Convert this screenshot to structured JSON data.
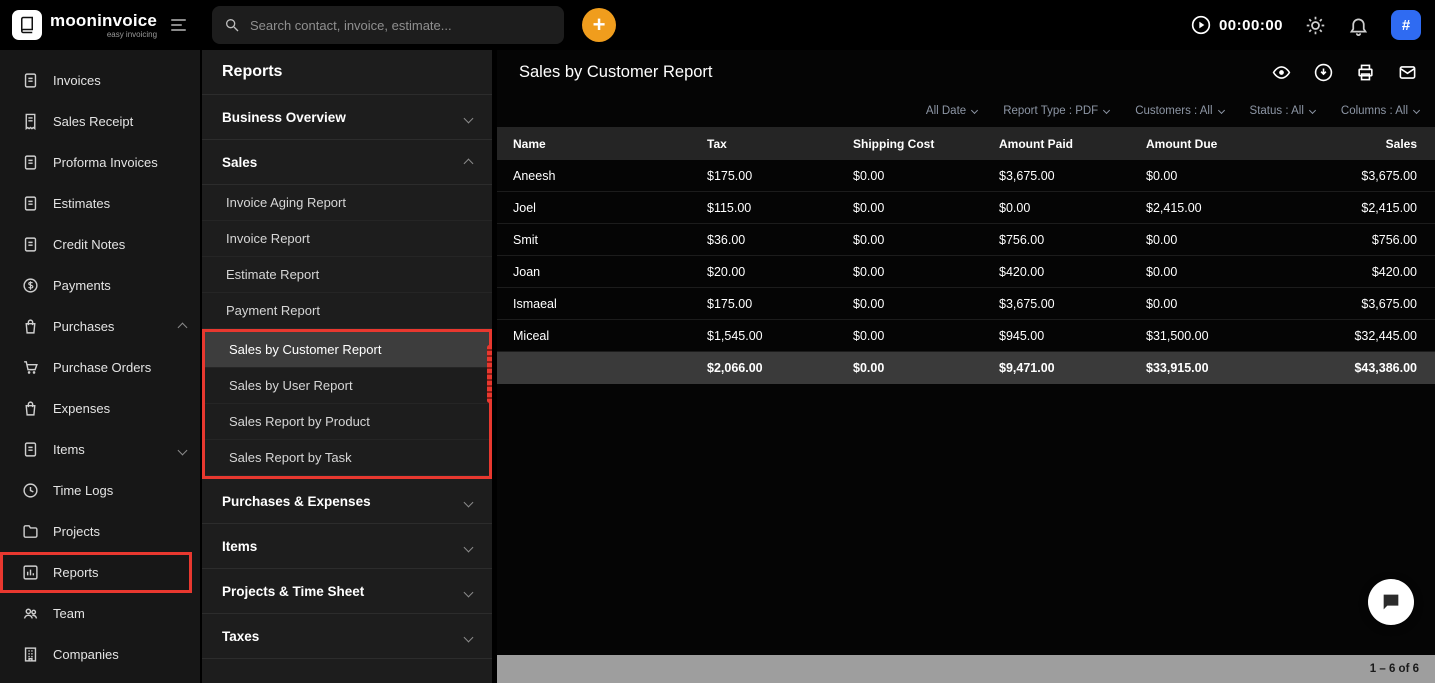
{
  "topbar": {
    "logo_text": "mooninvoice",
    "logo_tagline": "easy invoicing",
    "search_placeholder": "Search contact, invoice, estimate...",
    "add_label": "+",
    "timer": "00:00:00",
    "hash_label": "#"
  },
  "sidebar": {
    "items": [
      {
        "label": "Invoices"
      },
      {
        "label": "Sales Receipt"
      },
      {
        "label": "Proforma Invoices"
      },
      {
        "label": "Estimates"
      },
      {
        "label": "Credit Notes"
      },
      {
        "label": "Payments"
      },
      {
        "label": "Purchases"
      },
      {
        "label": "Purchase Orders"
      },
      {
        "label": "Expenses"
      },
      {
        "label": "Items"
      },
      {
        "label": "Time Logs"
      },
      {
        "label": "Projects"
      },
      {
        "label": "Reports"
      },
      {
        "label": "Team"
      },
      {
        "label": "Companies"
      }
    ]
  },
  "reports_panel": {
    "title": "Reports",
    "sections": [
      {
        "label": "Business Overview",
        "state": "collapsed"
      },
      {
        "label": "Sales",
        "state": "expanded"
      },
      {
        "label": "Purchases & Expenses",
        "state": "collapsed"
      },
      {
        "label": "Items",
        "state": "collapsed"
      },
      {
        "label": "Projects & Time Sheet",
        "state": "collapsed"
      },
      {
        "label": "Taxes",
        "state": "collapsed"
      }
    ],
    "sales_items": [
      {
        "label": "Invoice Aging Report"
      },
      {
        "label": "Invoice Report"
      },
      {
        "label": "Estimate Report"
      },
      {
        "label": "Payment Report"
      },
      {
        "label": "Sales by Customer Report",
        "selected": true
      },
      {
        "label": "Sales by User Report"
      },
      {
        "label": "Sales Report by Product"
      },
      {
        "label": "Sales Report by Task"
      }
    ]
  },
  "main": {
    "title": "Sales by Customer Report",
    "filters": [
      {
        "label": "All Date"
      },
      {
        "label": "Report Type : PDF"
      },
      {
        "label": "Customers : All"
      },
      {
        "label": "Status : All"
      },
      {
        "label": "Columns : All"
      }
    ],
    "table": {
      "columns": [
        "Name",
        "Tax",
        "Shipping Cost",
        "Amount Paid",
        "Amount Due",
        "Sales"
      ],
      "rows": [
        [
          "Aneesh",
          "$175.00",
          "$0.00",
          "$3,675.00",
          "$0.00",
          "$3,675.00"
        ],
        [
          "Joel",
          "$115.00",
          "$0.00",
          "$0.00",
          "$2,415.00",
          "$2,415.00"
        ],
        [
          "Smit",
          "$36.00",
          "$0.00",
          "$756.00",
          "$0.00",
          "$756.00"
        ],
        [
          "Joan",
          "$20.00",
          "$0.00",
          "$420.00",
          "$0.00",
          "$420.00"
        ],
        [
          "Ismaeal",
          "$175.00",
          "$0.00",
          "$3,675.00",
          "$0.00",
          "$3,675.00"
        ],
        [
          "Miceal",
          "$1,545.00",
          "$0.00",
          "$945.00",
          "$31,500.00",
          "$32,445.00"
        ]
      ],
      "totals": [
        "",
        "$2,066.00",
        "$0.00",
        "$9,471.00",
        "$33,915.00",
        "$43,386.00"
      ]
    },
    "pagination": "1 – 6 of 6"
  },
  "colors": {
    "accent_red": "#e8382f",
    "accent_orange": "#f09d1d",
    "accent_blue": "#2f6bf2"
  }
}
